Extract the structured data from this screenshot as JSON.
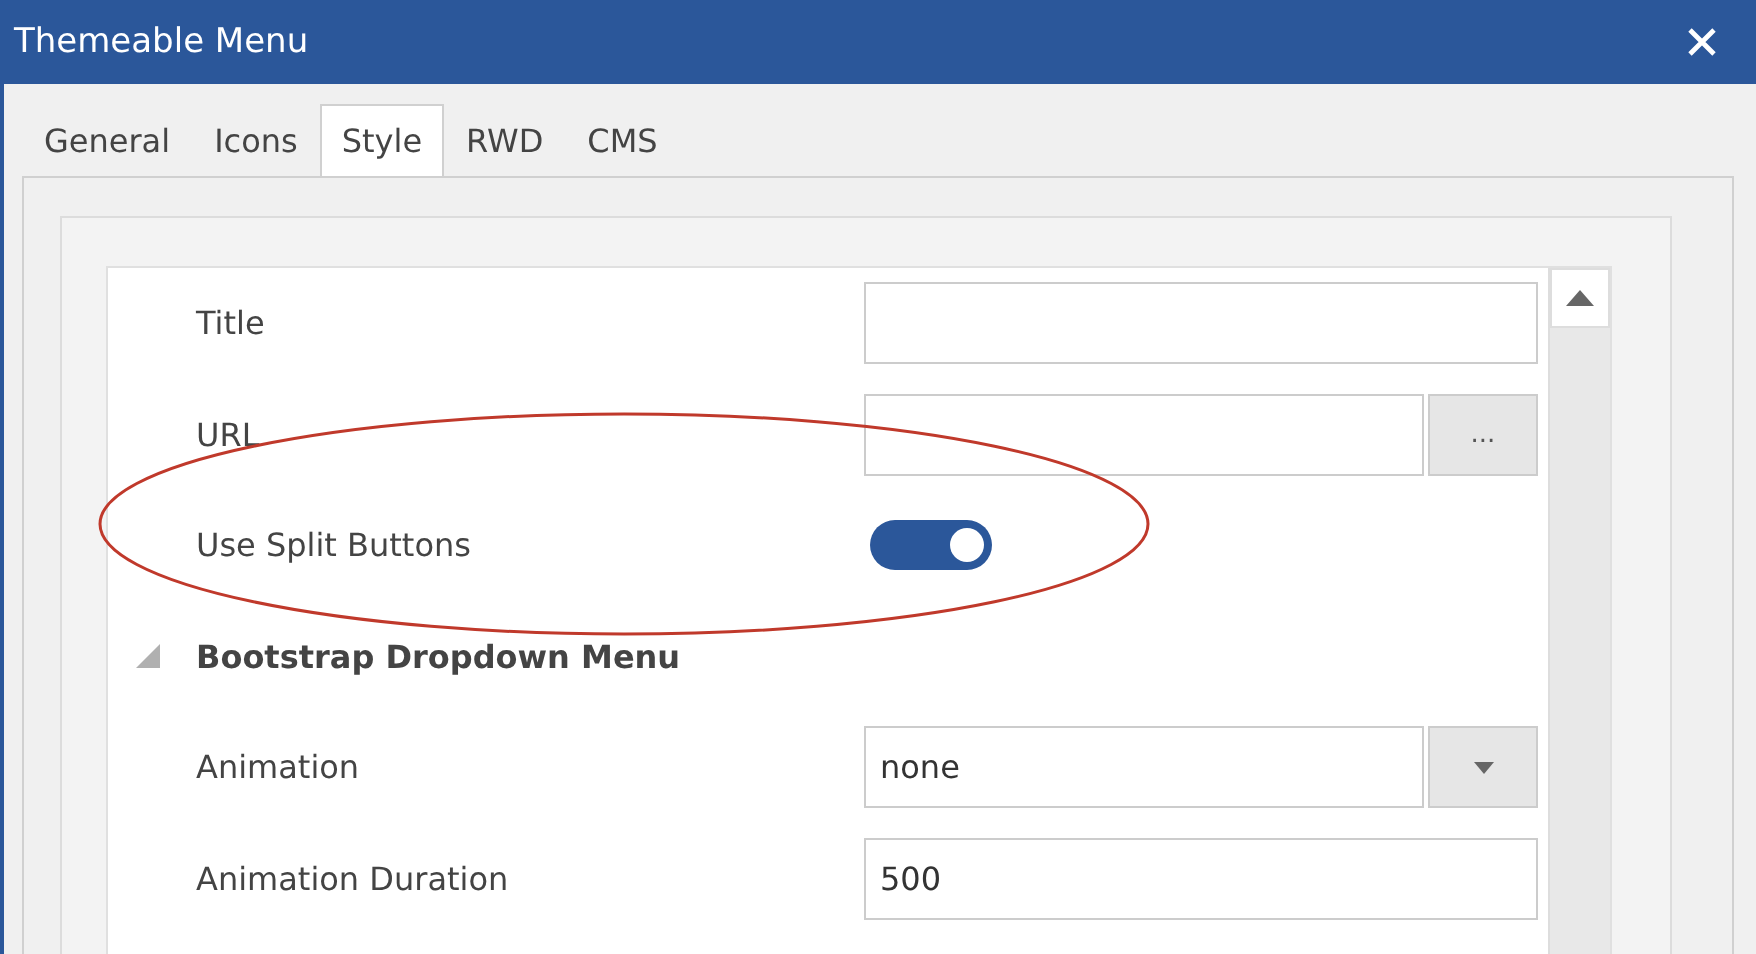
{
  "window": {
    "title": "Themeable Menu"
  },
  "tabs": [
    {
      "label": "General",
      "selected": false
    },
    {
      "label": "Icons",
      "selected": false
    },
    {
      "label": "Style",
      "selected": true
    },
    {
      "label": "RWD",
      "selected": false
    },
    {
      "label": "CMS",
      "selected": false
    }
  ],
  "properties": [
    {
      "kind": "text",
      "label": "Title"
    },
    {
      "kind": "browse",
      "label": "URL",
      "button": "..."
    },
    {
      "kind": "toggle",
      "label": "Use Split Buttons",
      "on": true
    },
    {
      "kind": "section",
      "label": "Bootstrap Dropdown Menu",
      "expanded": true
    },
    {
      "kind": "select",
      "label": "Animation",
      "value": "none"
    },
    {
      "kind": "text",
      "label": "Animation Duration",
      "value": "500"
    }
  ]
}
